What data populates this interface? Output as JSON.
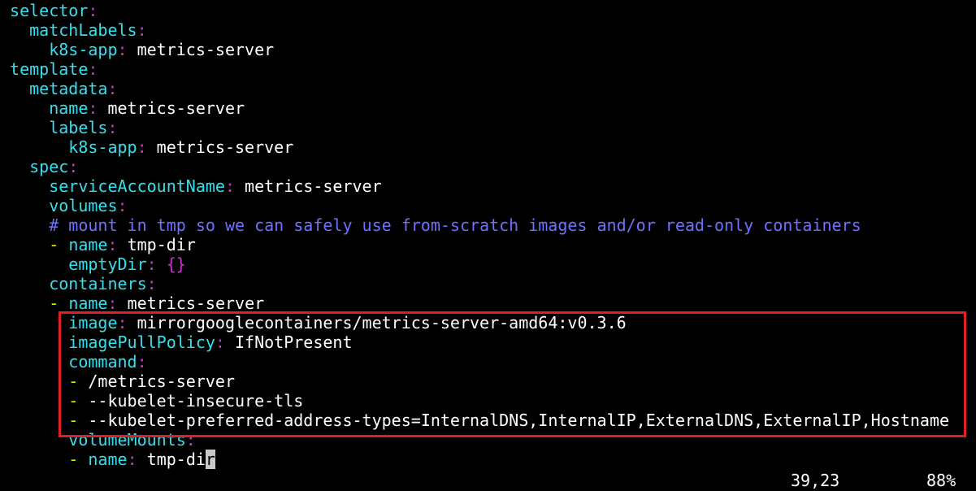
{
  "editor": {
    "lines": [
      {
        "indent": "",
        "key": "selector",
        "sep": ":"
      },
      {
        "indent": "  ",
        "key": "matchLabels",
        "sep": ":"
      },
      {
        "indent": "    ",
        "key": "k8s-app",
        "sep": ":",
        "value": " metrics-server"
      },
      {
        "indent": "",
        "key": "template",
        "sep": ":"
      },
      {
        "indent": "  ",
        "key": "metadata",
        "sep": ":"
      },
      {
        "indent": "    ",
        "key": "name",
        "sep": ":",
        "value": " metrics-server"
      },
      {
        "indent": "    ",
        "key": "labels",
        "sep": ":"
      },
      {
        "indent": "      ",
        "key": "k8s-app",
        "sep": ":",
        "value": " metrics-server"
      },
      {
        "indent": "  ",
        "key": "spec",
        "sep": ":"
      },
      {
        "indent": "    ",
        "key": "serviceAccountName",
        "sep": ":",
        "value": " metrics-server"
      },
      {
        "indent": "    ",
        "key": "volumes",
        "sep": ":"
      },
      {
        "indent": "    ",
        "comment": "# mount in tmp so we can safely use from-scratch images and/or read-only containers"
      },
      {
        "indent": "    ",
        "dash": "- ",
        "key": "name",
        "sep": ":",
        "value": " tmp-dir"
      },
      {
        "indent": "      ",
        "key": "emptyDir",
        "sep": ":",
        "braces": " {}"
      },
      {
        "indent": "    ",
        "key": "containers",
        "sep": ":"
      },
      {
        "indent": "    ",
        "dash": "- ",
        "key": "name",
        "sep": ":",
        "value": " metrics-server"
      },
      {
        "indent": "      ",
        "key": "image",
        "sep": ":",
        "value": " mirrorgooglecontainers/metrics-server-amd64:v0.3.6"
      },
      {
        "indent": "      ",
        "key": "imagePullPolicy",
        "sep": ":",
        "value": " IfNotPresent"
      },
      {
        "indent": "      ",
        "key": "command",
        "sep": ":"
      },
      {
        "indent": "      ",
        "dash": "- ",
        "value": "/metrics-server"
      },
      {
        "indent": "      ",
        "dash": "- ",
        "value": "--kubelet-insecure-tls"
      },
      {
        "indent": "      ",
        "dash": "- ",
        "value": "--kubelet-preferred-address-types=InternalDNS,InternalIP,ExternalDNS,ExternalIP,Hostname"
      },
      {
        "indent": "      ",
        "key": "volumeMounts",
        "sep": ":"
      },
      {
        "indent": "      ",
        "dash": "- ",
        "key": "name",
        "sep": ":",
        "value": " tmp-di",
        "cursor": "r"
      }
    ]
  },
  "statusbar": {
    "position": "39,23",
    "percent": "88%"
  },
  "colors": {
    "background": "#000000",
    "key": "#33e0ee",
    "punctuation": "#d030d0",
    "value": "#ffffff",
    "dash": "#e8e800",
    "comment": "#7070ff",
    "highlight_box": "#e02020"
  }
}
